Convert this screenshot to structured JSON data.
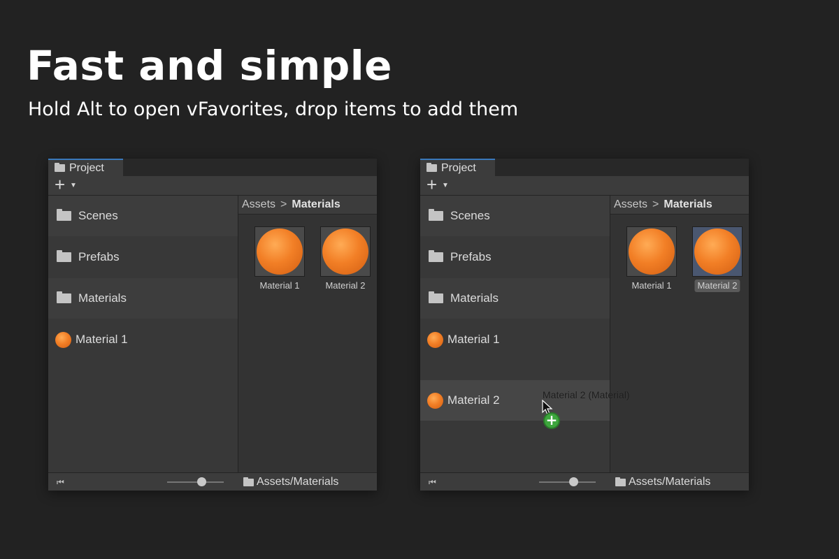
{
  "headline": "Fast and simple",
  "subline": "Hold Alt to open vFavorites, drop items to add them",
  "panels": {
    "left": {
      "tab_title": "Project",
      "toolbar": {
        "add_icon": "plus-icon",
        "dropdown_icon": "caret-down-icon"
      },
      "tree": [
        "Scenes",
        "Prefabs",
        "Materials",
        "Material 1"
      ],
      "breadcrumb": {
        "root": "Assets",
        "separator": ">",
        "current": "Materials"
      },
      "assets": [
        "Material 1",
        "Material 2"
      ],
      "footer": {
        "path": "Assets/Materials",
        "zoom_level": 0.55
      }
    },
    "right": {
      "tab_title": "Project",
      "toolbar": {
        "add_icon": "plus-icon",
        "dropdown_icon": "caret-down-icon"
      },
      "tree": [
        "Scenes",
        "Prefabs",
        "Materials",
        "Material 1",
        "Material 2"
      ],
      "breadcrumb": {
        "root": "Assets",
        "separator": ">",
        "current": "Materials"
      },
      "assets": [
        "Material 1",
        "Material 2"
      ],
      "selected_asset": "Material 2",
      "footer": {
        "path": "Assets/Materials",
        "zoom_level": 0.55
      },
      "drag": {
        "tooltip": "Material 2 (Material)",
        "badge": "+"
      }
    }
  },
  "colors": {
    "background": "#222222",
    "panel": "#383838",
    "tab_accent": "#3a79bb",
    "material_orange": "#f27f26",
    "add_badge": "#3da63d"
  }
}
